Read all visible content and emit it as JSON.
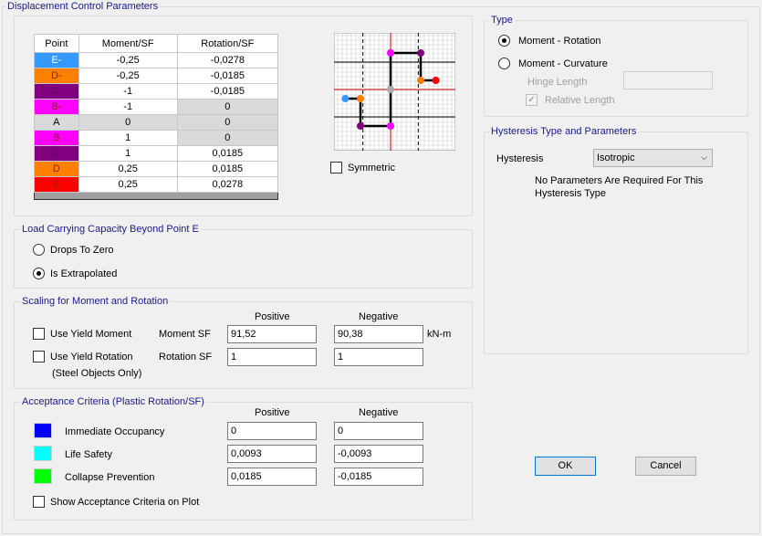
{
  "title": "Displacement Control Parameters",
  "table": {
    "headers": [
      "Point",
      "Moment/SF",
      "Rotation/SF"
    ],
    "rows": [
      {
        "point": "E-",
        "moment": "-0,25",
        "rotation": "-0,0278",
        "color": "#3399ff",
        "grey": false
      },
      {
        "point": "D-",
        "moment": "-0,25",
        "rotation": "-0,0185",
        "color": "#ff8000",
        "grey": false
      },
      {
        "point": "C-",
        "moment": "-1",
        "rotation": "-0,0185",
        "color": "#800080",
        "grey": false
      },
      {
        "point": "B-",
        "moment": "-1",
        "rotation": "0",
        "color": "#ff00ff",
        "grey": true
      },
      {
        "point": "A",
        "moment": "0",
        "rotation": "0",
        "color": "#d9d9d9",
        "grey": true,
        "greyAll": true
      },
      {
        "point": "B",
        "moment": "1",
        "rotation": "0",
        "color": "#ff00ff",
        "grey": true
      },
      {
        "point": "C",
        "moment": "1",
        "rotation": "0,0185",
        "color": "#800080",
        "grey": false
      },
      {
        "point": "D",
        "moment": "0,25",
        "rotation": "0,0185",
        "color": "#ff8000",
        "grey": false
      },
      {
        "point": "E",
        "moment": "0,25",
        "rotation": "0,0278",
        "color": "#ff0000",
        "grey": false
      }
    ]
  },
  "symmetric": {
    "label": "Symmetric",
    "checked": false
  },
  "load": {
    "title": "Load Carrying Capacity Beyond Point E",
    "options": [
      "Drops To Zero",
      "Is Extrapolated"
    ],
    "selected": 1
  },
  "scaling": {
    "title": "Scaling for Moment and Rotation",
    "positive": "Positive",
    "negative": "Negative",
    "use_yield_moment": "Use Yield Moment",
    "use_yield_rotation": "Use Yield Rotation",
    "steel_only": "(Steel Objects Only)",
    "moment_sf": "Moment SF",
    "rotation_sf": "Rotation SF",
    "moment_pos": "91,52",
    "moment_neg": "90,38",
    "unit": "kN-m",
    "rotation_pos": "1",
    "rotation_neg": "1"
  },
  "acceptance": {
    "title": "Acceptance Criteria (Plastic Rotation/SF)",
    "positive": "Positive",
    "negative": "Negative",
    "items": [
      {
        "label": "Immediate Occupancy",
        "color": "#0000ff",
        "pos": "0",
        "neg": "0"
      },
      {
        "label": "Life Safety",
        "color": "#00ffff",
        "pos": "0,0093",
        "neg": "-0,0093"
      },
      {
        "label": "Collapse Prevention",
        "color": "#00ff00",
        "pos": "0,0185",
        "neg": "-0,0185"
      }
    ],
    "show_on_plot": "Show Acceptance Criteria on Plot"
  },
  "type": {
    "title": "Type",
    "options": [
      "Moment - Rotation",
      "Moment - Curvature"
    ],
    "selected": 0,
    "hinge_length": "Hinge Length",
    "relative_length": "Relative Length"
  },
  "hysteresis": {
    "title": "Hysteresis Type and Parameters",
    "label": "Hysteresis",
    "value": "Isotropic",
    "note1": "No Parameters Are Required For This",
    "note2": "Hysteresis Type"
  },
  "buttons": {
    "ok": "OK",
    "cancel": "Cancel"
  }
}
